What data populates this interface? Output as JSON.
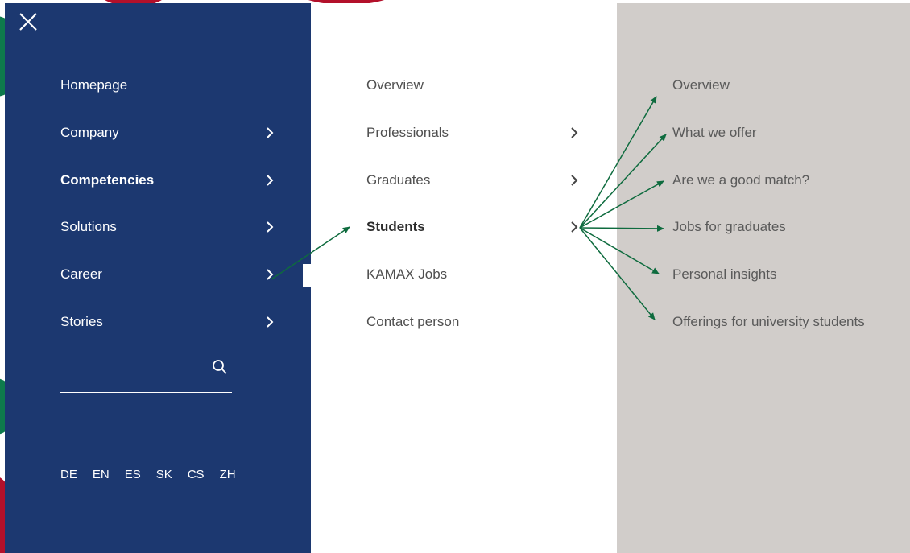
{
  "nav": {
    "close_icon": "close-icon",
    "items": [
      {
        "label": "Homepage"
      },
      {
        "label": "Company"
      },
      {
        "label": "Competencies"
      },
      {
        "label": "Solutions"
      },
      {
        "label": "Career"
      },
      {
        "label": "Stories"
      }
    ],
    "search": {
      "value": "",
      "placeholder": "",
      "icon": "search-icon"
    },
    "languages": [
      "DE",
      "EN",
      "ES",
      "SK",
      "CS",
      "ZH"
    ]
  },
  "submenu": {
    "items": [
      {
        "label": "Overview"
      },
      {
        "label": "Professionals"
      },
      {
        "label": "Graduates"
      },
      {
        "label": "Students"
      },
      {
        "label": "KAMAX Jobs"
      },
      {
        "label": "Contact person"
      }
    ]
  },
  "third_menu": {
    "items": [
      {
        "label": "Overview"
      },
      {
        "label": "What we offer"
      },
      {
        "label": "Are we a good match?"
      },
      {
        "label": "Jobs for graduates"
      },
      {
        "label": "Personal insights"
      },
      {
        "label": "Offerings for university students"
      }
    ]
  },
  "colors": {
    "nav_background": "#1c3870",
    "third_panel_background": "#d1cdca",
    "annotation_arrows": "#0e6b3e",
    "brand_red": "#b3102a",
    "brand_green": "#0e7a4c"
  }
}
